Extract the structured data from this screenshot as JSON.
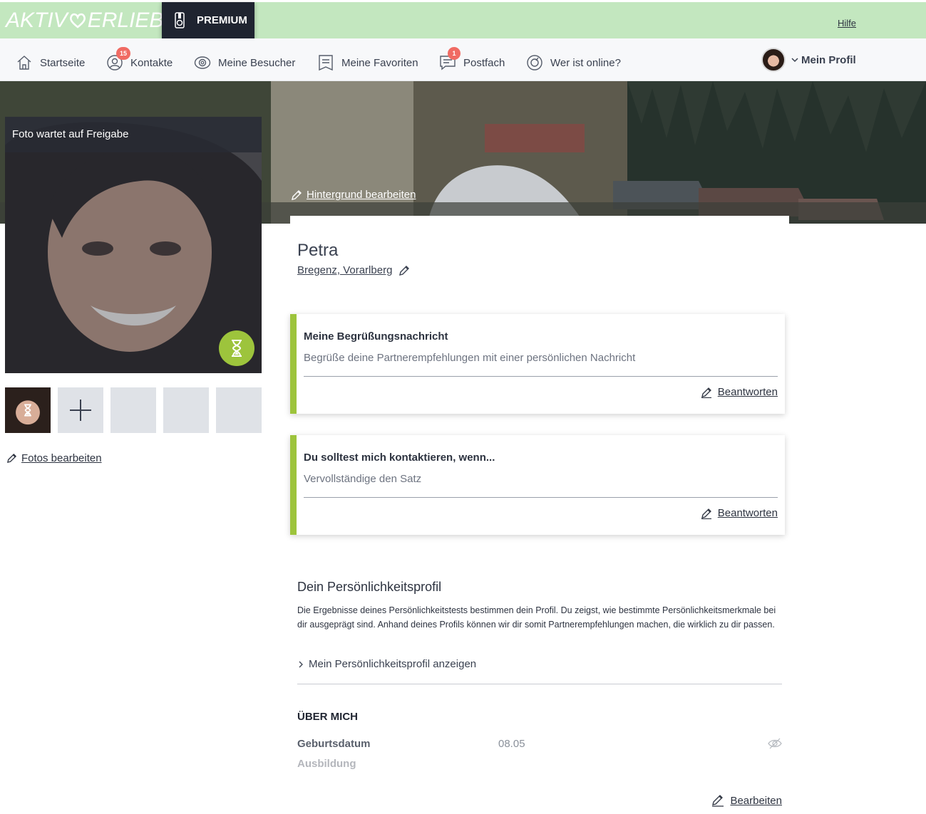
{
  "header": {
    "logo_left": "AKTIV",
    "logo_right": "ERLIEBT",
    "premium_label": "PREMIUM",
    "help_label": "Hilfe"
  },
  "nav": {
    "items": [
      {
        "label": "Startseite",
        "icon": "home-icon"
      },
      {
        "label": "Kontakte",
        "icon": "user-icon",
        "badge": "15"
      },
      {
        "label": "Meine Besucher",
        "icon": "eye-icon"
      },
      {
        "label": "Meine Favoriten",
        "icon": "bookmark-icon"
      },
      {
        "label": "Postfach",
        "icon": "message-icon",
        "badge": "1"
      },
      {
        "label": "Wer ist online?",
        "icon": "online-icon"
      }
    ],
    "profile_label": "Mein Profil"
  },
  "hero": {
    "edit_background_label": "Hintergrund bearbeiten"
  },
  "photo": {
    "status_label": "Foto wartet auf Freigabe",
    "edit_photos_label": "Fotos bearbeiten"
  },
  "profile": {
    "name": "Petra",
    "location": "Bregenz, Vorarlberg"
  },
  "questions": [
    {
      "title": "Meine Begrüßungsnachricht",
      "subtitle": "Begrüße deine Partnerempfehlungen mit einer persönlichen Nachricht",
      "action": "Beantworten"
    },
    {
      "title": "Du solltest mich kontaktieren, wenn...",
      "subtitle": "Vervollständige den Satz",
      "action": "Beantworten"
    }
  ],
  "personality": {
    "title": "Dein Persönlichkeitsprofil",
    "text": "Die Ergebnisse deines Persönlichkeitstests bestimmen dein Profil. Du zeigst, wie bestimmte Persönlichkeitsmerkmale bei dir ausgeprägt sind. Anhand deines Profils können wir dir somit Partnerempfehlungen machen, die wirklich zu dir passen.",
    "link": "Mein Persönlichkeitsprofil anzeigen"
  },
  "about": {
    "title": "ÜBER MICH",
    "rows": [
      {
        "label": "Geburtsdatum",
        "value": "08.05"
      },
      {
        "label": "Ausbildung",
        "value": ""
      }
    ],
    "edit_label": "Bearbeiten"
  },
  "colors": {
    "topbar": "#c3e7bf",
    "premium_bg": "#1f2430",
    "accent_green": "#9dc43c",
    "badge_red": "#f06b63"
  }
}
